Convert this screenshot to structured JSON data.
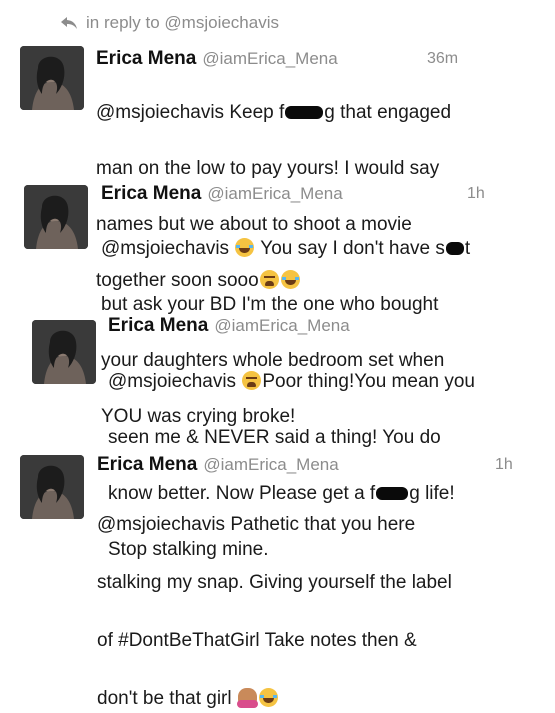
{
  "reply_context": {
    "icon": "reply-arrow-icon",
    "text": "in reply to @msjoiechavis"
  },
  "tweets": [
    {
      "author_name": "Erica Mena",
      "author_handle": "@iamErica_Mena",
      "time": "36m",
      "segments": [
        "@msjoiechavis Keep f",
        "g that engaged",
        "man on the low to pay yours! I would say",
        "names but we about to shoot a movie",
        "together soon sooo"
      ]
    },
    {
      "author_name": "Erica Mena",
      "author_handle": "@iamErica_Mena",
      "time": "1h",
      "segments": [
        "@msjoiechavis",
        "You say I don't have s",
        "t",
        "but ask your BD I'm the one who bought",
        "your daughters whole bedroom set when",
        "YOU was crying broke!"
      ]
    },
    {
      "author_name": "Erica Mena",
      "author_handle": "@iamErica_Mena",
      "time": "",
      "segments": [
        "@msjoiechavis",
        "Poor thing!You mean you",
        "seen me & NEVER said a thing! You do",
        "know better. Now Please get a f",
        "g life!",
        "Stop stalking mine."
      ]
    },
    {
      "author_name": "Erica Mena",
      "author_handle": "@iamErica_Mena",
      "time": "1h",
      "segments": [
        "@msjoiechavis Pathetic that you here",
        "stalking my snap. Giving yourself the label",
        "of #DontBeThatGirl Take notes then &",
        "don't be that girl"
      ]
    }
  ],
  "emoji": {
    "weary": "weary-face-emoji",
    "joy": "tears-of-joy-emoji",
    "nogood": "no-good-gesture-emoji"
  },
  "colors": {
    "text": "#1a1a1a",
    "muted": "#8c8c8c",
    "redaction": "#0a0a0a"
  }
}
